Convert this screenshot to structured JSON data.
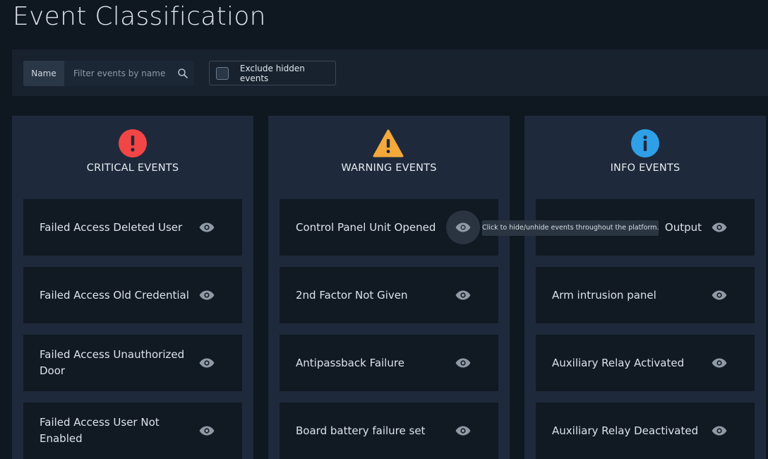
{
  "page": {
    "title": "Event Classification"
  },
  "filters": {
    "name_label": "Name",
    "search_placeholder": "Filter events by name",
    "search_value": "",
    "exclude_hidden_label": "Exclude hidden events",
    "exclude_hidden_checked": false
  },
  "tooltip": {
    "text": "Click to hide/unhide events throughout the platform."
  },
  "colors": {
    "critical": "#f24646",
    "warning": "#f5a93b",
    "info": "#2f9fe8"
  },
  "columns": [
    {
      "title": "CRITICAL EVENTS",
      "icon": "critical-icon",
      "items": [
        {
          "label": "Failed Access Deleted User"
        },
        {
          "label": "Failed Access Old Credential"
        },
        {
          "label": "Failed Access Unauthorized Door"
        },
        {
          "label": "Failed Access User Not Enabled"
        }
      ]
    },
    {
      "title": "WARNING EVENTS",
      "icon": "warning-icon",
      "items": [
        {
          "label": "Control Panel Unit Opened"
        },
        {
          "label": "2nd Factor Not Given"
        },
        {
          "label": "Antipassback Failure"
        },
        {
          "label": "Board battery failure set"
        }
      ]
    },
    {
      "title": "INFO EVENTS",
      "icon": "info-icon",
      "items": [
        {
          "label": "Output"
        },
        {
          "label": "Arm intrusion panel"
        },
        {
          "label": "Auxiliary Relay Activated"
        },
        {
          "label": "Auxiliary Relay Deactivated"
        }
      ]
    }
  ]
}
